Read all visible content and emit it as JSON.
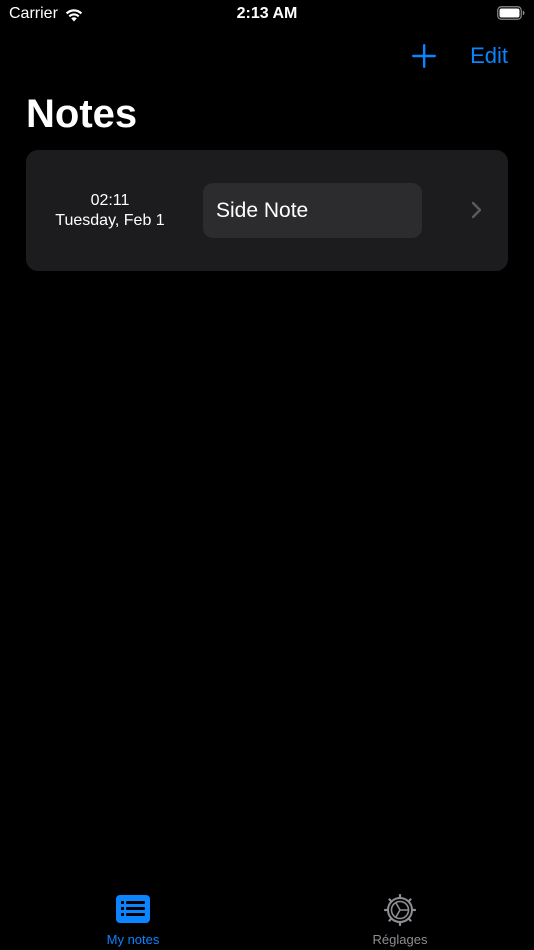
{
  "status_bar": {
    "carrier": "Carrier",
    "time": "2:13 AM",
    "wifi_icon": "wifi-icon",
    "battery_icon": "battery-icon"
  },
  "nav": {
    "add_icon": "plus-icon",
    "edit_label": "Edit"
  },
  "page_title": "Notes",
  "notes": [
    {
      "time": "02:11",
      "date": "Tuesday, Feb 1",
      "title": "Side Note",
      "chevron_icon": "chevron-right-icon"
    }
  ],
  "tabs": [
    {
      "label": "My notes",
      "icon": "notes-list-icon",
      "selected": true
    },
    {
      "label": "Réglages",
      "icon": "gear-icon",
      "selected": false
    }
  ],
  "colors": {
    "background": "#000000",
    "accent": "#0a84ff",
    "card": "#1c1c1e",
    "title_box": "#2c2c2e",
    "inactive_tab": "#8e8e93"
  }
}
